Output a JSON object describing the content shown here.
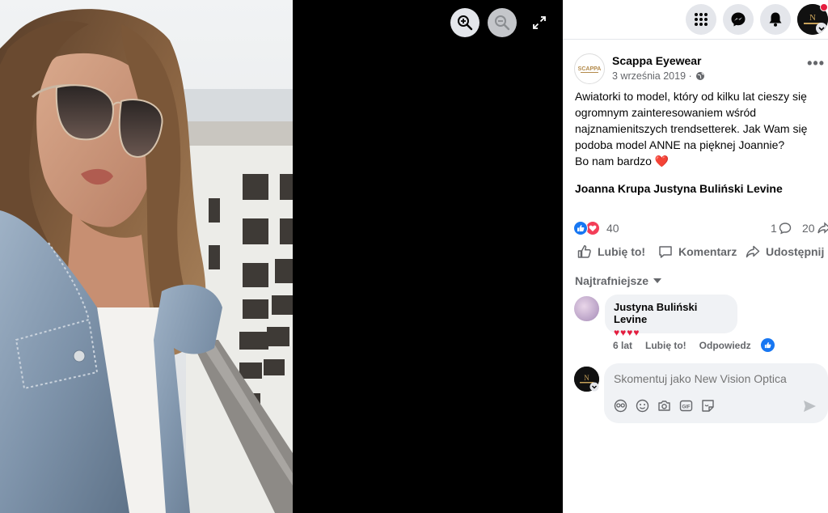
{
  "viewer": {
    "zoom_in_icon": "zoom-in-icon",
    "zoom_out_icon": "zoom-out-icon",
    "expand_icon": "expand-icon"
  },
  "topbar": {
    "icons": [
      "grid-menu-icon",
      "messenger-icon",
      "bell-icon"
    ],
    "profile_avatar": "New Vision Optica"
  },
  "post": {
    "page_name": "Scappa Eyewear",
    "date": "3 września 2019 ·",
    "more_label": "•••",
    "text_lines": [
      "Awiatorki to model, który od kilku lat cieszy się",
      "ogromnym zainteresowaniem wśród",
      "najznamienitszych trendsetterek. Jak Wam się",
      "podoba model ANNE na pięknej Joannie?",
      "Bo nam bardzo"
    ],
    "heart_emoji": "❤️",
    "tags": "Joanna Krupa Justyna Buliński Levine",
    "reactions_count": "40",
    "comments_count": "1",
    "shares_count": "20",
    "actions": {
      "like": "Lubię to!",
      "comment": "Komentarz",
      "share": "Udostępnij"
    },
    "sort_label": "Najtrafniejsze"
  },
  "comment": {
    "author": "Justyna Buliński Levine",
    "text": "♥♥♥♥",
    "time": "6 lat",
    "like_label": "Lubię to!",
    "reply_label": "Odpowiedz"
  },
  "reply_box": {
    "placeholder": "Skomentuj jako New Vision Optica",
    "tools": [
      "sticker-icon",
      "emoji-icon",
      "camera-icon",
      "gif-icon",
      "avatar-sticker-icon"
    ]
  },
  "colors": {
    "brand_blue": "#1877f2",
    "love_red": "#e41e3f",
    "secondary_text": "#65676b"
  }
}
